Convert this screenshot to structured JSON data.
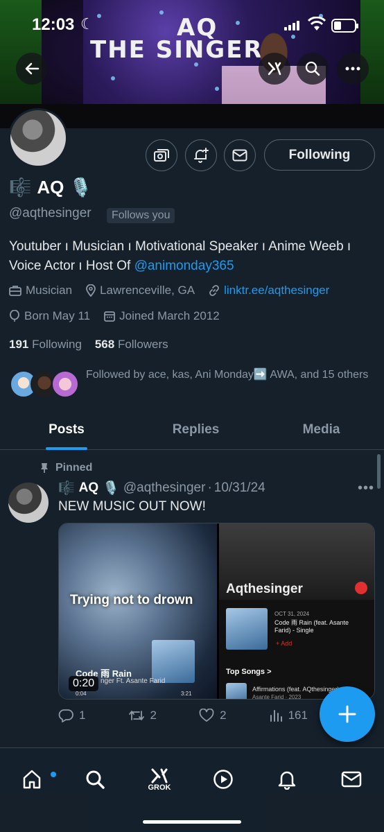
{
  "status_bar": {
    "time": "12:03"
  },
  "banner": {
    "line1": "AQ",
    "line2": "THE SINGER"
  },
  "profile": {
    "name": "AQ",
    "handle": "@aqthesinger",
    "follows_you": "Follows you",
    "following_button": "Following",
    "bio_text": "Youtuber ı Musician ı Motivational Speaker ı Anime Weeb ı Voice Actor ı Host Of ",
    "bio_link": "@animonday365",
    "category": "Musician",
    "location": "Lawrenceville, GA",
    "website": "linktr.ee/aqthesinger",
    "born": "Born May 11",
    "joined": "Joined March 2012",
    "following_count": "191",
    "following_label": "Following",
    "followers_count": "568",
    "followers_label": "Followers",
    "followed_by": "Followed by ace, kas, Ani Monday➡️ AWA, and 15 others"
  },
  "tabs": [
    {
      "label": "Posts",
      "active": true
    },
    {
      "label": "Replies",
      "active": false
    },
    {
      "label": "Media",
      "active": false
    }
  ],
  "post": {
    "pinned_label": "Pinned",
    "author_name": "AQ",
    "author_handle": "@aqthesinger",
    "separator": "·",
    "date": "10/31/24",
    "text": "NEW MUSIC OUT NOW!",
    "media": {
      "left_caption": "Trying not to drown",
      "song_title": "Code 雨 Rain",
      "song_artist": "nger Ft. Asante Farid",
      "video_time": "0:20",
      "progress_start": "0:04",
      "progress_end": "3:21",
      "right_artist": "Aqthesinger",
      "release_date": "OCT 31, 2024",
      "release_title": "Code 雨 Rain (feat. Asante Farid) - Single",
      "add_label": "+ Add",
      "top_songs_label": "Top Songs >",
      "top_song_1": "Affirmations (feat. AQthesinger)",
      "top_song_1_meta": "Asante Farid · 2023"
    },
    "replies": "1",
    "reposts": "2",
    "likes": "2",
    "views": "161"
  },
  "nav": {
    "grok_label": "GROK"
  },
  "colors": {
    "accent": "#1d9bf0",
    "background": "#15202b",
    "muted": "#8b98a5"
  }
}
